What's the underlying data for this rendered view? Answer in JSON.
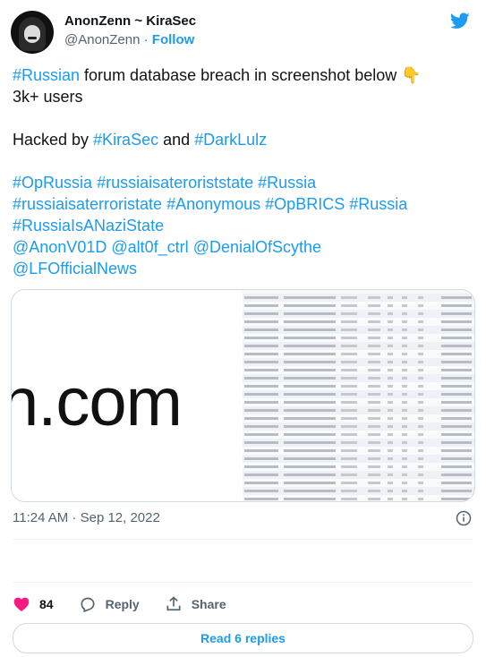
{
  "author": {
    "display_name": "AnonZenn ~ KiraSec",
    "handle": "@AnonZenn",
    "separator": "·",
    "follow_label": "Follow"
  },
  "tweet": {
    "line1": [
      {
        "text": "#Russian",
        "tag": true
      },
      {
        "text": " forum database breach in screenshot below 👇",
        "tag": false
      }
    ],
    "line2": "3k+ users",
    "line3": [
      {
        "text": "Hacked by ",
        "tag": false
      },
      {
        "text": "#KiraSec",
        "tag": true
      },
      {
        "text": " and ",
        "tag": false
      },
      {
        "text": "#DarkLulz",
        "tag": true
      }
    ],
    "hashtags_block": [
      [
        {
          "text": "#OpRussia",
          "tag": true
        },
        {
          "text": " ",
          "tag": false
        },
        {
          "text": "#russiaisateroriststate",
          "tag": true
        },
        {
          "text": " ",
          "tag": false
        },
        {
          "text": "#Russia",
          "tag": true
        }
      ],
      [
        {
          "text": "#russiaisaterroristate",
          "tag": true
        },
        {
          "text": " ",
          "tag": false
        },
        {
          "text": "#Anonymous",
          "tag": true
        },
        {
          "text": " ",
          "tag": false
        },
        {
          "text": "#OpBRICS",
          "tag": true
        },
        {
          "text": " ",
          "tag": false
        },
        {
          "text": "#Russia",
          "tag": true
        }
      ],
      [
        {
          "text": "#RussiaIsANaziState",
          "tag": true
        }
      ],
      [
        {
          "text": "@AnonV01D",
          "tag": true
        },
        {
          "text": " ",
          "tag": false
        },
        {
          "text": "@alt0f_ctrl",
          "tag": true
        },
        {
          "text": " ",
          "tag": false
        },
        {
          "text": "@DenialOfScythe",
          "tag": true
        }
      ],
      [
        {
          "text": "@LFOfficialNews",
          "tag": true
        }
      ]
    ]
  },
  "media": {
    "left_image_text": "n.com",
    "right_image_icon": "database-table-screenshot"
  },
  "timestamp": "11:24 AM · Sep 12, 2022",
  "actions": {
    "like_count": "84",
    "reply_label": "Reply",
    "share_label": "Share"
  },
  "read_replies_label": "Read 6 replies",
  "colors": {
    "accent": "#1d9bf0",
    "like": "#f91880",
    "text": "#0f1419",
    "muted": "#536471"
  },
  "icons": [
    "twitter-bird-icon",
    "info-icon",
    "heart-icon",
    "reply-icon",
    "share-icon"
  ]
}
